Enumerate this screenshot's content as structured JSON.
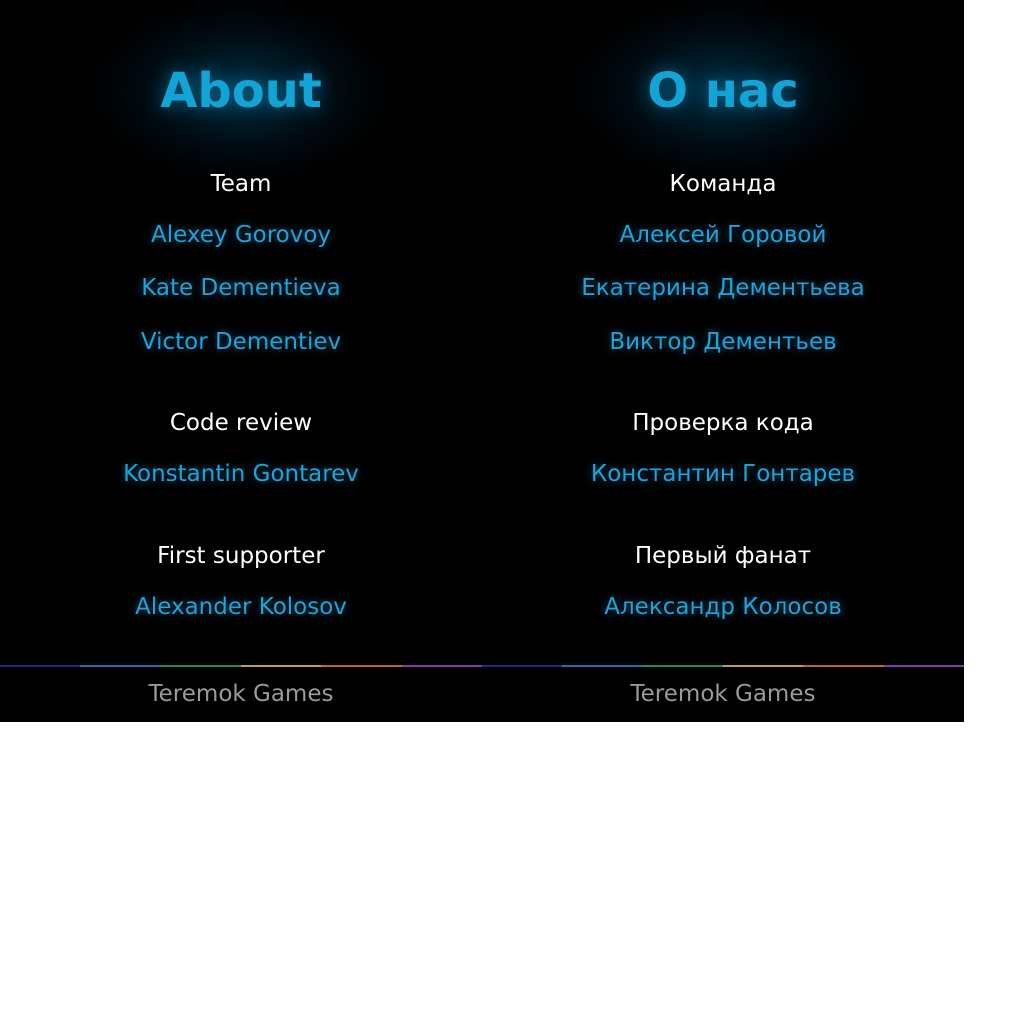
{
  "colors": {
    "background": "#000000",
    "title": "#12a4d6",
    "heading": "#ffffff",
    "name": "#1aa6d8",
    "footer": "#9a9a9a",
    "divider": [
      "#1f2a8f",
      "#1d6fa8",
      "#1a8f5a",
      "#c2a13b",
      "#c4652c",
      "#7a3aa8",
      "#1f2a8f",
      "#1d6fa8",
      "#1a8f5a",
      "#c2a13b",
      "#c4652c",
      "#7a3aa8"
    ]
  },
  "english": {
    "title": "About",
    "team": {
      "heading": "Team",
      "members": [
        "Alexey Gorovoy",
        "Kate Dementieva",
        "Victor Dementiev"
      ]
    },
    "code_review": {
      "heading": "Code review",
      "members": [
        "Konstantin Gontarev"
      ]
    },
    "first_supporter": {
      "heading": "First supporter",
      "members": [
        "Alexander Kolosov"
      ]
    },
    "footer": "Teremok Games"
  },
  "russian": {
    "title": "О нас",
    "team": {
      "heading": "Команда",
      "members": [
        "Алексей Горовой",
        "Екатерина Дементьева",
        "Виктор Дементьев"
      ]
    },
    "code_review": {
      "heading": "Проверка кода",
      "members": [
        "Константин Гонтарев"
      ]
    },
    "first_supporter": {
      "heading": "Первый фанат",
      "members": [
        "Александр Колосов"
      ]
    },
    "footer": "Teremok Games"
  }
}
